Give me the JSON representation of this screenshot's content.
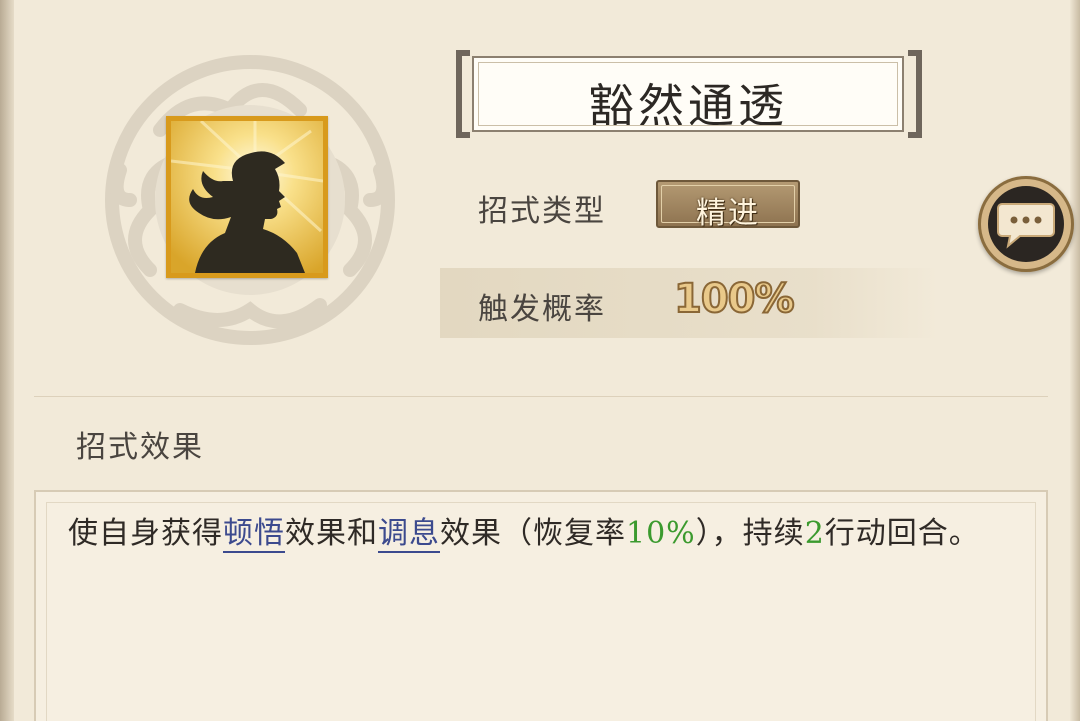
{
  "skill": {
    "name": "豁然通透",
    "icon": "silhouette-enlightenment-icon"
  },
  "attributes": {
    "type_label": "招式类型",
    "type_value": "精进",
    "probability_label": "触发概率",
    "probability_value": "100%"
  },
  "chat_button": {
    "icon": "speech-bubble-icon"
  },
  "effect": {
    "section_title": "招式效果",
    "text_1": "使自身获得",
    "keyword_1": "顿悟",
    "text_2": "效果和",
    "keyword_2": "调息",
    "text_3": "效果（恢复率",
    "rate": "10%",
    "text_4": "），持续",
    "turns": "2",
    "text_5": "行动回合。"
  },
  "colors": {
    "keyword": "#3c4a8e",
    "number": "#3b9a2e",
    "icon_gold": "#d89a1c",
    "background": "#f2ead9"
  }
}
